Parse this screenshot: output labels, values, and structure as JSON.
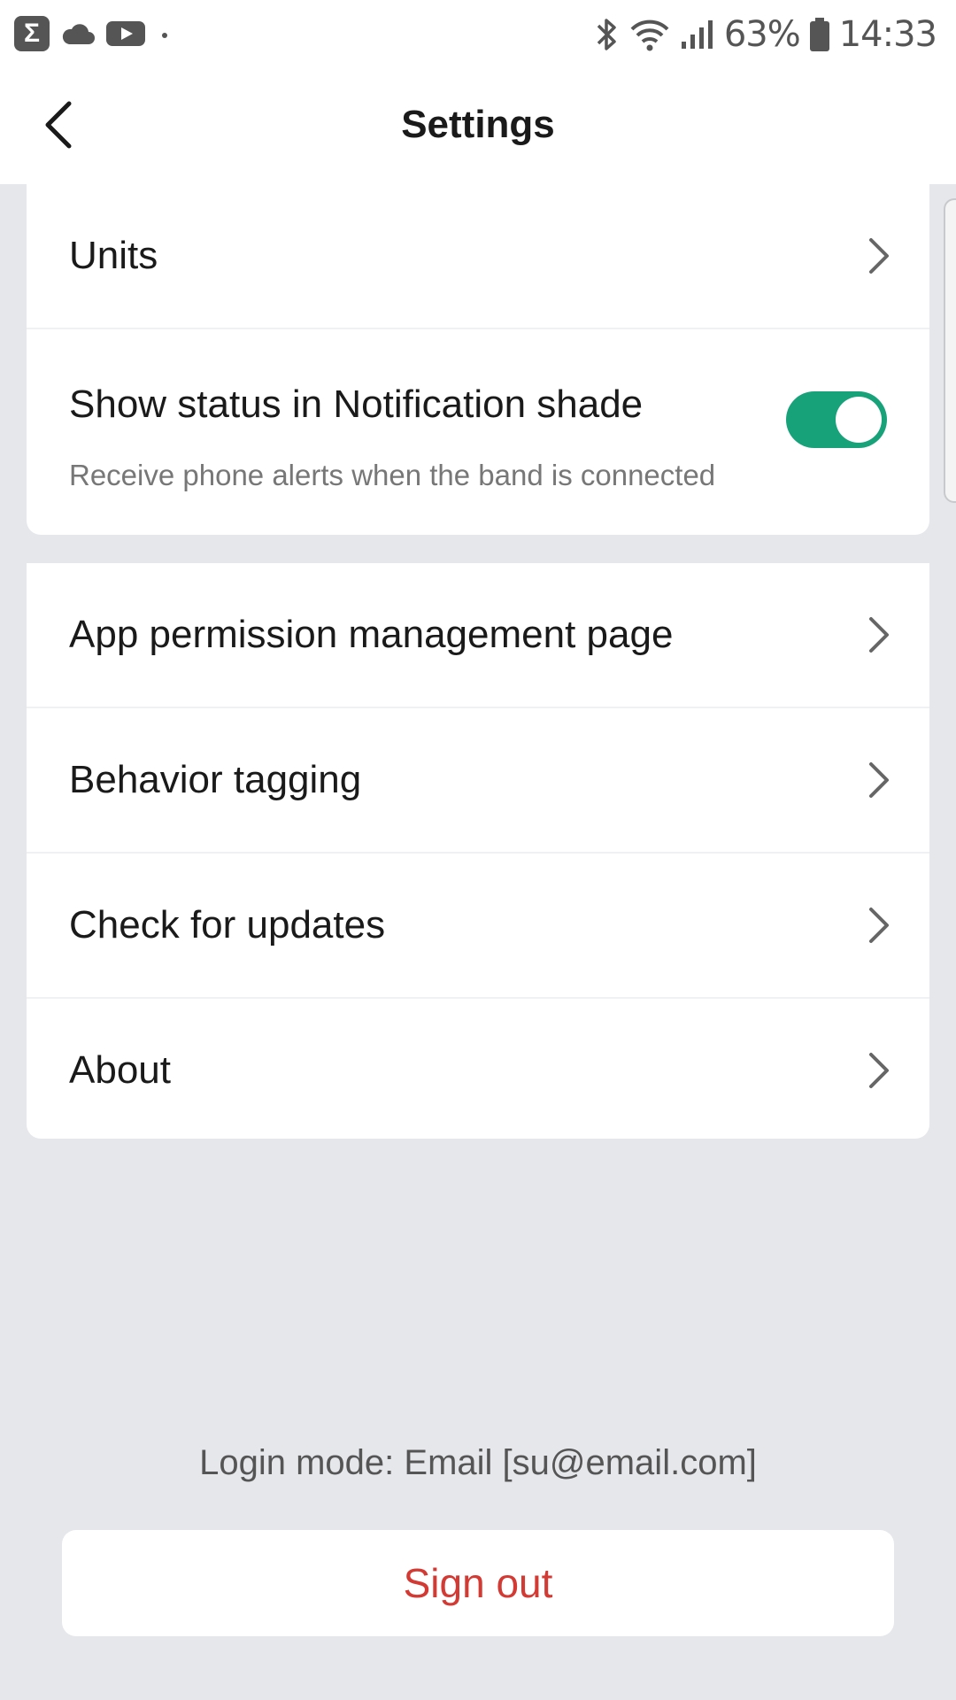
{
  "status_bar": {
    "left_icons": [
      "sigma-app-icon",
      "cloud-icon",
      "youtube-icon",
      "dot-icon"
    ],
    "right_icons": [
      "bluetooth-icon",
      "wifi-icon",
      "signal-icon",
      "battery-icon"
    ],
    "battery_percent": "63%",
    "time": "14:33"
  },
  "header": {
    "back_icon": "chevron-left-icon",
    "title": "Settings"
  },
  "section_1": {
    "units_label": "Units",
    "notification_label": "Show status in Notification shade",
    "notification_sub": "Receive phone alerts when the band is connected",
    "notification_enabled": true
  },
  "section_2": {
    "items": [
      {
        "label": "App permission management page"
      },
      {
        "label": "Behavior tagging"
      },
      {
        "label": "Check for updates"
      },
      {
        "label": "About"
      }
    ]
  },
  "footer": {
    "login_mode": "Login mode: Email [su@email.com]",
    "sign_out_label": "Sign out"
  },
  "colors": {
    "background": "#e6e7eb",
    "toggle_on": "#17a27a",
    "sign_out": "#d33a33"
  }
}
